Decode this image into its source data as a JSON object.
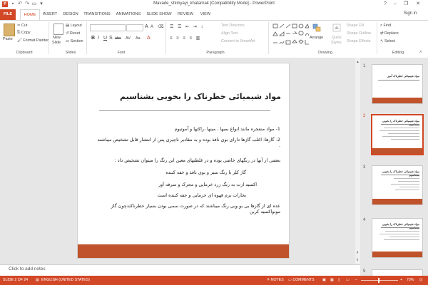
{
  "window": {
    "title": "Mavade_shimyayi_khatarnak [Compatibility Mode] - PowerPoint",
    "help": "?",
    "minimize": "–",
    "restore": "❐",
    "close": "✕"
  },
  "tabs": {
    "file": "FILE",
    "home": "HOME",
    "insert": "INSERT",
    "design": "DESIGN",
    "transitions": "TRANSITIONS",
    "animations": "ANIMATIONS",
    "slideshow": "SLIDE SHOW",
    "review": "REVIEW",
    "view": "VIEW",
    "signin": "Sign in"
  },
  "ribbon": {
    "clipboard": {
      "paste": "Paste",
      "cut": "Cut",
      "copy": "Copy",
      "format_painter": "Format Painter",
      "label": "Clipboard"
    },
    "slides": {
      "new_slide": "New",
      "new_slide2": "Slide",
      "layout": "Layout",
      "reset": "Reset",
      "section": "Section",
      "label": "Slides"
    },
    "font": {
      "label": "Font",
      "bold": "B",
      "italic": "I",
      "underline": "U",
      "strike": "S",
      "shadow": "abc",
      "spacing": "AV",
      "case": "Aa",
      "color": "A"
    },
    "paragraph": {
      "label": "Paragraph",
      "text_direction": "Text Direction",
      "align_text": "Align Text",
      "smartart": "Convert to SmartArt"
    },
    "drawing": {
      "label": "Drawing",
      "arrange": "Arrange",
      "quick_styles": "Quick",
      "quick_styles2": "Styles",
      "fill": "Shape Fill",
      "outline": "Shape Outline",
      "effects": "Shape Effects"
    },
    "editing": {
      "label": "Editing",
      "find": "Find",
      "replace": "Replace",
      "select": "Select"
    }
  },
  "slide": {
    "title": "مواد شیمیائی خطرناک را بخوبی بشناسیم",
    "lines": [
      "1- مواد منفجره  مانند انواع بمبها ، مینها ،راکتها و آموتیوم",
      "2- گازها:  اغلب گازها دارای بوی نافذ بوده  و به مقادیر ناچیزی پس از انتشار قابل تشخیص میباشند .",
      "بعضی از آنها در رنگهای خاصی بوده و در غلظتهای معین این رنگ را میتوان تشخیص داد :",
      "گاز کلر با رنگ سبز  و بوی نافذ و خفه کننده",
      "اکسید ازت به رنگ زرد خرمایی  و محرک و سرفه آور",
      "بخارات برم قهوه ای خرمایی و خفه کننده است",
      "عده ای از گازها بی بو وبی رنگ  میباشند که در صورت سمی بودن بسیار خطرناکندچون گاز مونواکسید کربن"
    ]
  },
  "thumbnails": [
    {
      "num": "1",
      "title": "مواد شیمیائی خطرناک آمیز"
    },
    {
      "num": "2",
      "title": "مواد شیمیائی خطرناک را بخوبی بشناسیم"
    },
    {
      "num": "3",
      "title": "مواد شیمیائی خطرناک را بخوبی بشناسیم"
    },
    {
      "num": "4",
      "title": "مواد شیمیائی خطرناک را بخوبی بشناسیم"
    }
  ],
  "notes": {
    "placeholder": "Click to add notes"
  },
  "status": {
    "slide": "SLIDE 2 OF 24",
    "language": "ENGLISH (UNITED STATES)",
    "notes": "NOTES",
    "comments": "COMMENTS",
    "zoom": "70%"
  },
  "colors": {
    "accent": "#d24726",
    "slide_bar": "#c0532b"
  }
}
